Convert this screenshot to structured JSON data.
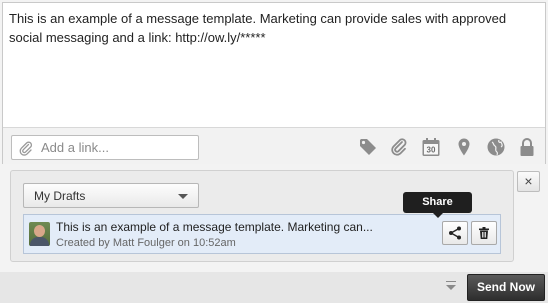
{
  "composer": {
    "message": "This is an example of a message template. Marketing can provide sales with approved social messaging and a link: http://ow.ly/*****",
    "link_placeholder": "Add a link...",
    "toolbar_icons": [
      "tag-icon",
      "attachment-icon",
      "calendar-icon",
      "location-pin-icon",
      "globe-icon",
      "lock-icon"
    ],
    "calendar_day": "30"
  },
  "drafts": {
    "selected_folder": "My Drafts",
    "items": [
      {
        "text": "This is an example of a message template. Marketing can...",
        "meta": "Created by Matt Foulger on 10:52am"
      }
    ],
    "tooltip": "Share"
  },
  "close_label": "×",
  "footer": {
    "send_label": "Send Now"
  }
}
